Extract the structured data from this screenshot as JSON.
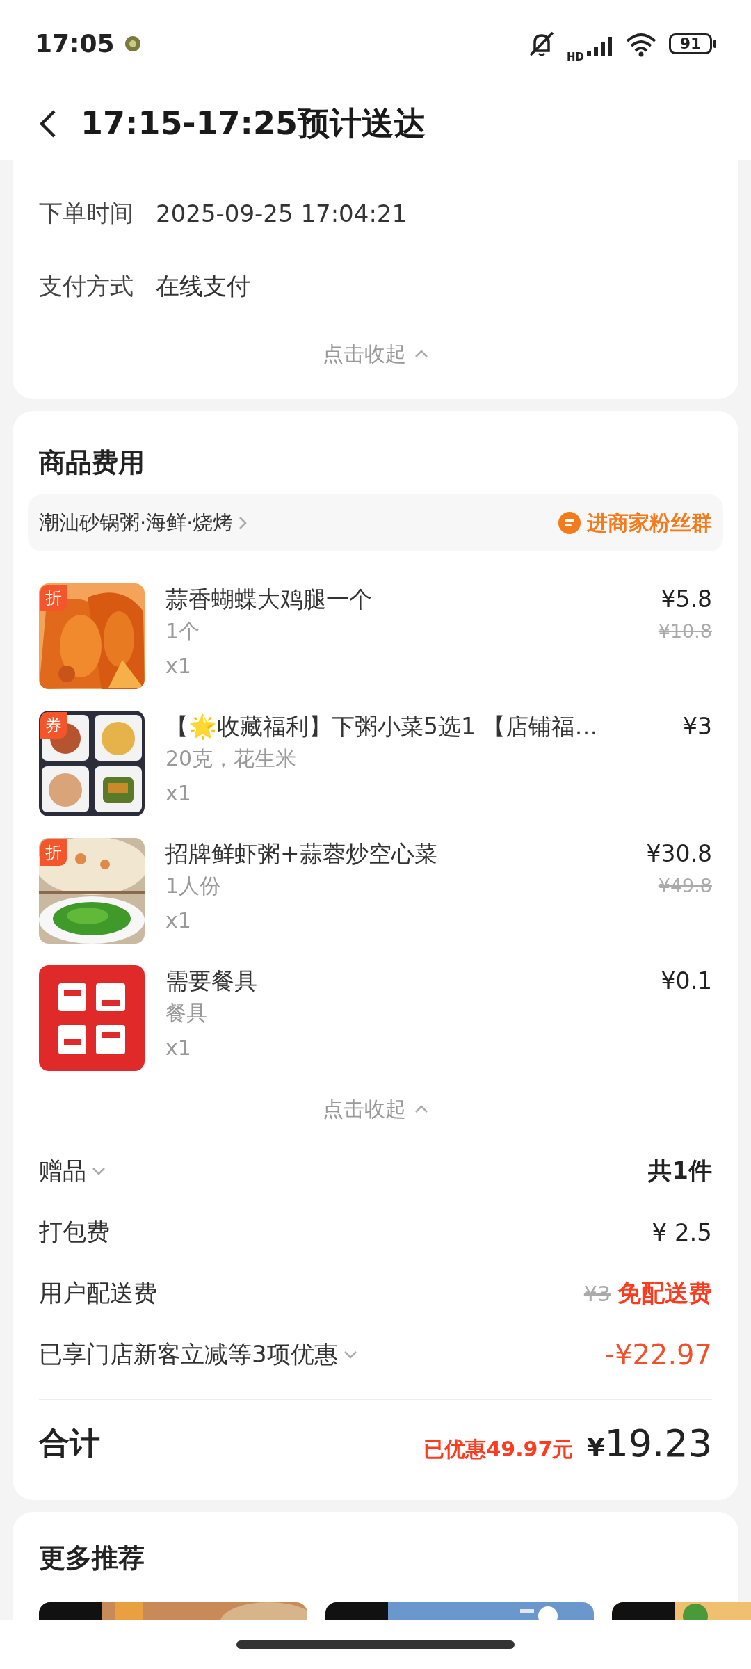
{
  "status_bar": {
    "time": "17:05",
    "battery": "91",
    "network": "HD"
  },
  "header": {
    "title": "17:15-17:25预计送达"
  },
  "order_info": {
    "rows": [
      {
        "label": "下单时间",
        "value": "2025-09-25 17:04:21"
      },
      {
        "label": "支付方式",
        "value": "在线支付"
      }
    ],
    "collapse": "点击收起"
  },
  "goods": {
    "title": "商品费用",
    "shop": {
      "name": "潮汕砂锅粥·海鲜·烧烤",
      "group_link": "进商家粉丝群"
    },
    "items": [
      {
        "badge": "折",
        "name": "蒜香蝴蝶大鸡腿一个",
        "spec": "1个",
        "qty": "x1",
        "price": "¥5.8",
        "original_price": "¥10.8"
      },
      {
        "badge": "券",
        "name": "【🌟收藏福利】下粥小菜5选1 【店铺福…",
        "spec": "20克，花生米",
        "qty": "x1",
        "price": "¥3"
      },
      {
        "badge": "折",
        "name": "招牌鲜虾粥+蒜蓉炒空心菜",
        "spec": "1人份",
        "qty": "x1",
        "price": "¥30.8",
        "original_price": "¥49.8"
      },
      {
        "name": "需要餐具",
        "spec": "餐具",
        "qty": "x1",
        "price": "¥0.1"
      }
    ],
    "collapse": "点击收起",
    "fees": [
      {
        "kind": "gift",
        "label": "赠品",
        "value": "共1件"
      },
      {
        "kind": "plain",
        "label": "打包费",
        "value": "¥ 2.5"
      },
      {
        "kind": "delivery",
        "label": "用户配送费",
        "original": "¥3",
        "value": "免配送费"
      },
      {
        "kind": "discount",
        "label": "已享门店新客立减等3项优惠",
        "value": "-¥22.97"
      }
    ],
    "total": {
      "label": "合计",
      "saved": "已优惠49.97元",
      "currency": "¥",
      "amount": "19.23"
    }
  },
  "recommend": {
    "title": "更多推荐"
  }
}
